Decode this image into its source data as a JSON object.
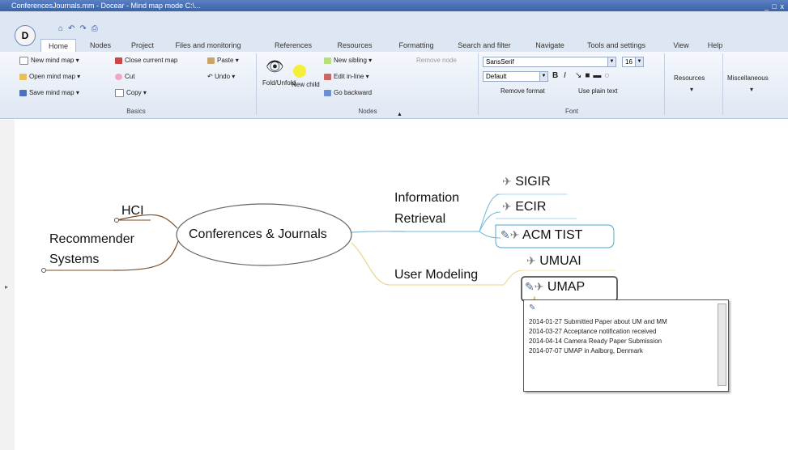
{
  "window": {
    "title": "ConferencesJournals.mm - Docear - Mind map mode C:\\...",
    "controls": "_ □ x"
  },
  "app_button": "D",
  "tabs": [
    "Home",
    "Nodes",
    "Project",
    "Files and monitoring",
    "References",
    "Resources",
    "Formatting",
    "Search and filter",
    "Navigate",
    "Tools and settings",
    "View",
    "Help"
  ],
  "ribbon": {
    "basics": {
      "label": "Basics",
      "new_map": "New mind map",
      "open_map": "Open mind map",
      "save_map": "Save mind map",
      "close_map": "Close current map",
      "cut": "Cut",
      "copy": "Copy",
      "paste": "Paste",
      "undo": "Undo"
    },
    "nodes": {
      "label": "Nodes",
      "fold": "Fold/Unfold",
      "new_child": "New child",
      "new_sibling": "New sibling",
      "edit": "Edit in-line",
      "goto": "Go backward",
      "remove": "Remove node"
    },
    "font": {
      "label": "Font",
      "family": "SansSerif",
      "size": "16",
      "style": "Default",
      "remove_format": "Remove format",
      "use_plain": "Use plain text"
    },
    "resources": "Resources",
    "misc": "Miscellaneous"
  },
  "mindmap": {
    "root": "Conferences & Journals",
    "left": [
      {
        "label": "HCI"
      },
      {
        "label_line1": "Recommender",
        "label_line2": "Systems"
      }
    ],
    "right": [
      {
        "label_line1": "Information",
        "label_line2": "Retrieval",
        "children": [
          "SIGIR",
          "ECIR",
          "ACM TIST"
        ]
      },
      {
        "label": "User Modeling",
        "children": [
          "UMUAI",
          "UMAP"
        ]
      }
    ]
  },
  "tooltip": {
    "lines": [
      "2014-01-27 Submitted Paper about UM and MM",
      "2014-03-27 Acceptance notification received",
      "2014-04-14 Camera Ready Paper Submission",
      "2014-07-07 UMAP in Aalborg, Denmark"
    ]
  },
  "colors": {
    "branch_ir": "#6fb7d6",
    "branch_um": "#e7d58a",
    "branch_left": "#7a4f2a",
    "root_border": "#666666"
  }
}
